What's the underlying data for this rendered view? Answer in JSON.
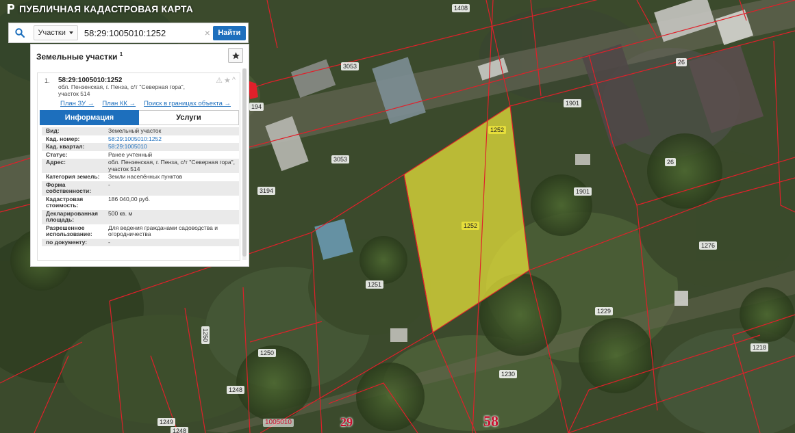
{
  "app": {
    "title": "ПУБЛИЧНАЯ КАДАСТРОВАЯ КАРТА"
  },
  "search": {
    "type_label": "Участки",
    "query": "58:29:1005010:1252",
    "clear_glyph": "×",
    "find_label": "Найти"
  },
  "panel": {
    "title": "Земельные участки",
    "count": "1",
    "result": {
      "index": "1.",
      "cad_number": "58:29:1005010:1252",
      "address_short": "обл. Пензенская, г. Пенза, с/т \"Северная гора\", участок 514",
      "links": [
        "План ЗУ →",
        "План КК →",
        "Поиск в границах объекта →"
      ],
      "tabs": [
        "Информация",
        "Услуги"
      ],
      "fields": [
        {
          "k": "Вид:",
          "v": "Земельный участок",
          "link": false
        },
        {
          "k": "Кад. номер:",
          "v": "58:29:1005010:1252",
          "link": true
        },
        {
          "k": "Кад. квартал:",
          "v": "58:29:1005010",
          "link": true
        },
        {
          "k": "Статус:",
          "v": "Ранее учтенный",
          "link": false
        },
        {
          "k": "Адрес:",
          "v": "обл. Пензенская, г. Пенза, с/т \"Северная гора\", участок 514",
          "link": false
        },
        {
          "k": "Категория земель:",
          "v": "Земли населённых пунктов",
          "link": false
        },
        {
          "k": "Форма собственности:",
          "v": "-",
          "link": false
        },
        {
          "k": "Кадастровая стоимость:",
          "v": "186 040,00 руб.",
          "link": false
        },
        {
          "k": "Декларированная площадь:",
          "v": "500 кв. м",
          "link": false
        },
        {
          "k": "Разрешенное использование:",
          "v": "Для ведения гражданами садоводства и огородничества",
          "link": false
        },
        {
          "k": "по документу:",
          "v": "-",
          "link": false
        }
      ]
    }
  },
  "map": {
    "parcel_labels": [
      {
        "text": "1408",
        "yellow": false
      },
      {
        "text": "3053",
        "yellow": false
      },
      {
        "text": "3053",
        "yellow": false
      },
      {
        "text": "3194",
        "yellow": false
      },
      {
        "text": "194",
        "yellow": false
      },
      {
        "text": "1901",
        "yellow": false
      },
      {
        "text": "1901",
        "yellow": false
      },
      {
        "text": "26",
        "yellow": false
      },
      {
        "text": "26",
        "yellow": false
      },
      {
        "text": "1252",
        "yellow": true
      },
      {
        "text": "1252",
        "yellow": true
      },
      {
        "text": "1251",
        "yellow": false
      },
      {
        "text": "1276",
        "yellow": false
      },
      {
        "text": "1229",
        "yellow": false
      },
      {
        "text": "1218",
        "yellow": false
      },
      {
        "text": "1230",
        "yellow": false
      },
      {
        "text": "1250",
        "yellow": false
      },
      {
        "text": "1248",
        "yellow": false
      },
      {
        "text": "1249",
        "yellow": false
      },
      {
        "text": "1248",
        "yellow": false
      },
      {
        "text": "1250",
        "yellow": false
      },
      {
        "text": "1005010",
        "yellow": false
      }
    ],
    "big_labels": [
      "29",
      "58"
    ],
    "colors": {
      "boundary": "#e0202a",
      "selected_fill": "#e6e03a",
      "panel_accent": "#1d6fbd"
    }
  }
}
